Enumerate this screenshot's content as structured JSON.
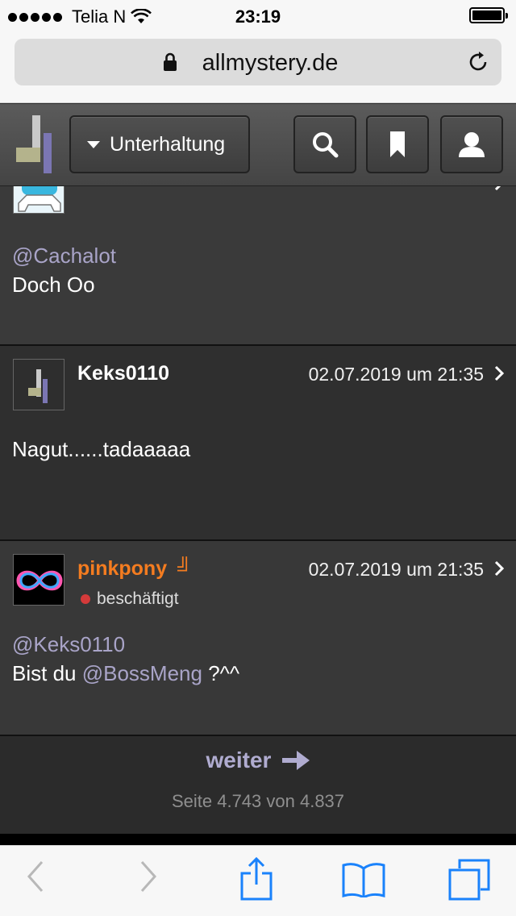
{
  "status_bar": {
    "carrier": "Telia N",
    "time": "23:19"
  },
  "browser": {
    "url": "allmystery.de"
  },
  "site_nav": {
    "category_label": "Unterhaltung"
  },
  "posts": [
    {
      "author": "",
      "mention": "@Cachalot",
      "text": "Doch Oo"
    },
    {
      "author": "Keks0110",
      "date": "02.07.2019 um 21:35",
      "text": "Nagut......tadaaaaa"
    },
    {
      "author": "pinkpony",
      "author_badge": "╝",
      "date": "02.07.2019 um 21:35",
      "status": "beschäftigt",
      "mention": "@Keks0110",
      "text_prefix": "Bist du",
      "text_mention": "@BossMeng",
      "text_suffix": "?^^"
    }
  ],
  "pagination": {
    "next_label": "weiter",
    "page_info": "Seite 4.743 von 4.837"
  },
  "colors": {
    "accent_mention": "#a9a4c8",
    "author_highlight": "#f47c20",
    "status_busy": "#d43a3a",
    "ios_blue": "#1a82fb"
  },
  "icons": [
    "wifi-icon",
    "lock-icon",
    "reload-icon",
    "site-logo",
    "search-icon",
    "bookmark-icon",
    "user-icon",
    "chevron-right-icon",
    "arrow-right-icon",
    "back-icon",
    "forward-icon",
    "share-icon",
    "bookmarks-icon",
    "tabs-icon"
  ]
}
